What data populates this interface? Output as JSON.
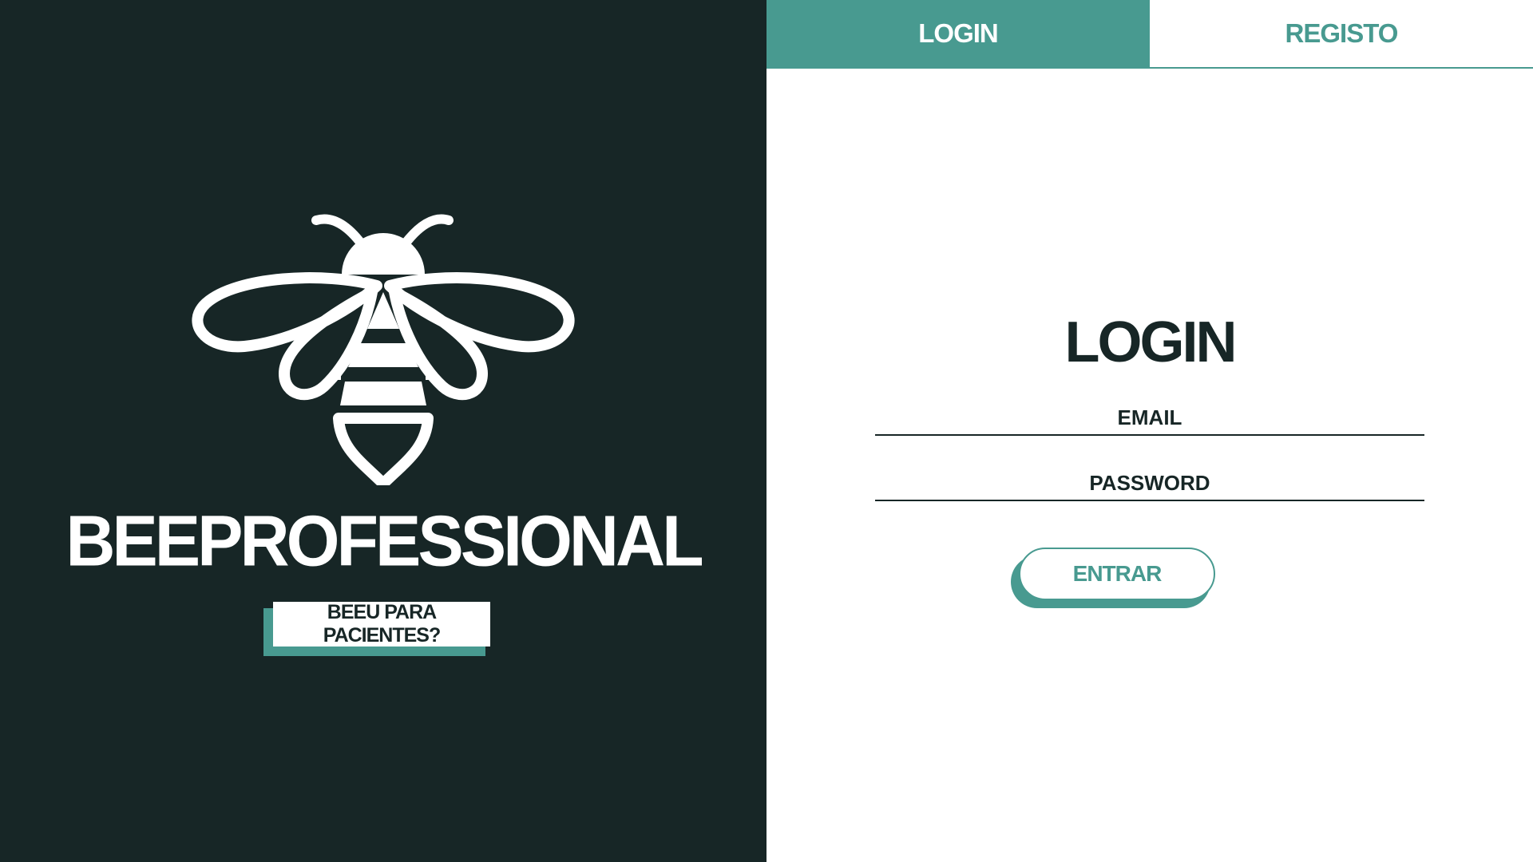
{
  "brand": {
    "logo_icon": "bee-icon",
    "name": "BEEPROFESSIONAL",
    "patients_button_label": "BEEU PARA PACIENTES?"
  },
  "tabs": {
    "login_label": "LOGIN",
    "register_label": "REGISTO",
    "active": "login"
  },
  "form": {
    "title": "LOGIN",
    "email_placeholder": "EMAIL",
    "email_value": "",
    "password_placeholder": "PASSWORD",
    "password_value": "",
    "submit_label": "ENTRAR"
  },
  "colors": {
    "dark": "#172626",
    "accent": "#489a90",
    "white": "#ffffff"
  }
}
